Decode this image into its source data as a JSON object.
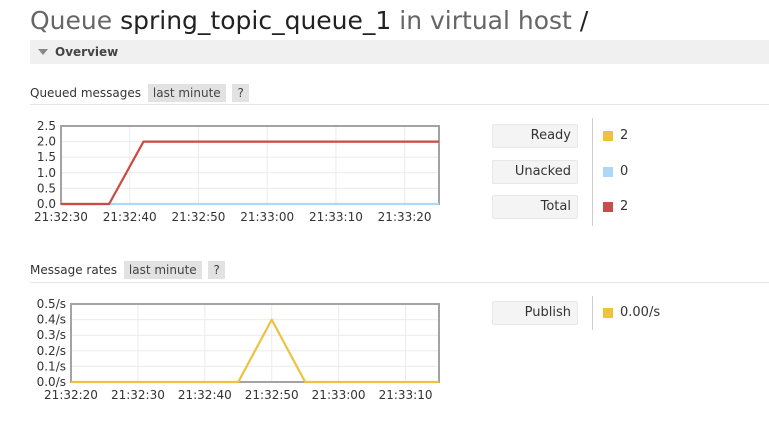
{
  "header": {
    "prefix": "Queue",
    "queue_name": "spring_topic_queue_1",
    "middle": "in virtual host",
    "vhost": "/"
  },
  "overview": {
    "label": "Overview"
  },
  "queued": {
    "title": "Queued messages",
    "range_label": "last minute",
    "help_label": "?",
    "legend": [
      {
        "label": "Ready",
        "value": "2",
        "color": "#edc240"
      },
      {
        "label": "Unacked",
        "value": "0",
        "color": "#afd8f8"
      },
      {
        "label": "Total",
        "value": "2",
        "color": "#cb4b4b"
      }
    ]
  },
  "rates": {
    "title": "Message rates",
    "range_label": "last minute",
    "help_label": "?",
    "legend": [
      {
        "label": "Publish",
        "value": "0.00/s",
        "color": "#edc240"
      }
    ]
  },
  "chart_data": [
    {
      "type": "line",
      "title": "Queued messages",
      "x_ticks": [
        "21:32:30",
        "21:32:40",
        "21:32:50",
        "21:33:00",
        "21:33:10",
        "21:33:20"
      ],
      "x_range": [
        "21:32:30",
        "21:33:25"
      ],
      "y_ticks": [
        "0.0",
        "0.5",
        "1.0",
        "1.5",
        "2.0",
        "2.5"
      ],
      "ylim": [
        0,
        2.5
      ],
      "grid": true,
      "series": [
        {
          "name": "Ready",
          "color": "#edc240",
          "x": [
            "21:32:30",
            "21:32:37",
            "21:32:42",
            "21:33:25"
          ],
          "y": [
            0,
            0,
            2,
            2
          ]
        },
        {
          "name": "Unacked",
          "color": "#afd8f8",
          "x": [
            "21:32:30",
            "21:33:25"
          ],
          "y": [
            0,
            0
          ]
        },
        {
          "name": "Total",
          "color": "#cb4b4b",
          "x": [
            "21:32:30",
            "21:32:37",
            "21:32:42",
            "21:33:25"
          ],
          "y": [
            0,
            0,
            2,
            2
          ]
        }
      ]
    },
    {
      "type": "line",
      "title": "Message rates",
      "x_ticks": [
        "21:32:20",
        "21:32:30",
        "21:32:40",
        "21:32:50",
        "21:33:00",
        "21:33:10"
      ],
      "x_range": [
        "21:32:20",
        "21:33:15"
      ],
      "y_ticks": [
        "0.0/s",
        "0.1/s",
        "0.2/s",
        "0.3/s",
        "0.4/s",
        "0.5/s"
      ],
      "ylim": [
        0,
        0.5
      ],
      "grid": true,
      "series": [
        {
          "name": "Publish",
          "color": "#edc240",
          "x": [
            "21:32:20",
            "21:32:45",
            "21:32:50",
            "21:32:55",
            "21:33:15"
          ],
          "y": [
            0,
            0,
            0.4,
            0,
            0
          ]
        }
      ]
    }
  ]
}
